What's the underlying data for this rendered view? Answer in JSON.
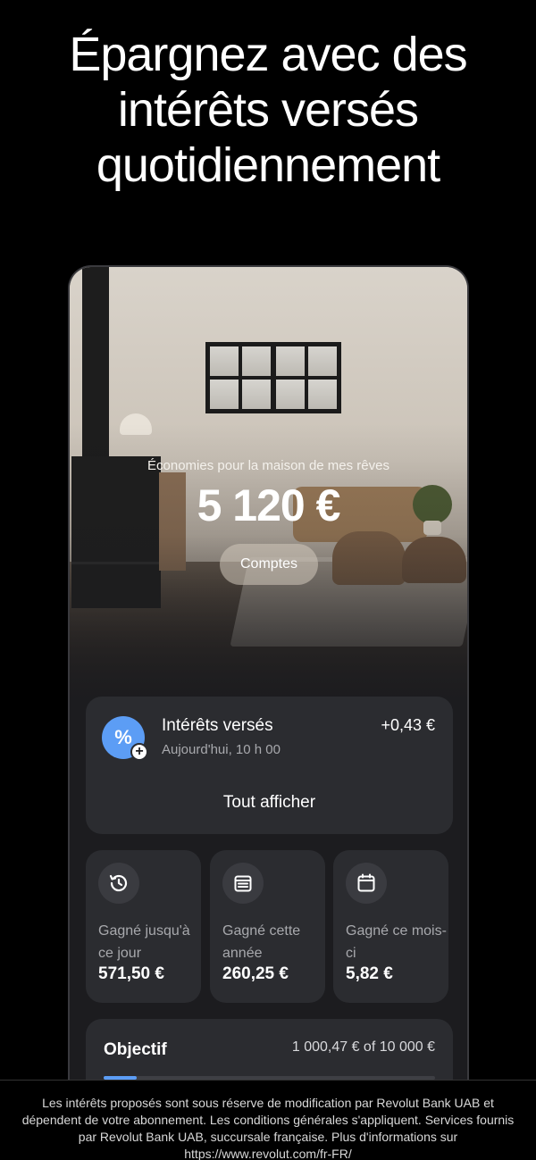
{
  "headline": {
    "line1": "Épargnez avec des",
    "line2": "intérêts versés",
    "line3": "quotidiennement"
  },
  "hero": {
    "label": "Économies pour la maison de mes rêves",
    "amount": "5 120 €",
    "comptes_button": "Comptes"
  },
  "interest": {
    "icon": "percent-icon",
    "title": "Intérêts versés",
    "subtitle": "Aujourd'hui, 10 h 00",
    "amount": "+0,43 €",
    "see_all": "Tout afficher"
  },
  "stats": [
    {
      "icon": "history-icon",
      "label": "Gagné jusqu'à ce jour",
      "value": "571,50 €"
    },
    {
      "icon": "calendar-year-icon",
      "label": "Gagné cette année",
      "value": "260,25 €"
    },
    {
      "icon": "calendar-month-icon",
      "label": "Gagné ce mois-ci",
      "value": "5,82 €"
    }
  ],
  "goal": {
    "title": "Objectif",
    "progress_text": "1 000,47 € of 10 000 €",
    "progress_fraction": 0.1
  },
  "disclaimer": "Les intérêts proposés sont sous réserve de modification par Revolut Bank UAB et dépendent de votre abonnement. Les conditions générales s'appliquent. Services fournis par Revolut Bank UAB, succursale française. Plus d'informations sur https://www.revolut.com/fr-FR/",
  "colors": {
    "background": "#000000",
    "card": "#2b2c30",
    "accent": "#5c9df5"
  }
}
